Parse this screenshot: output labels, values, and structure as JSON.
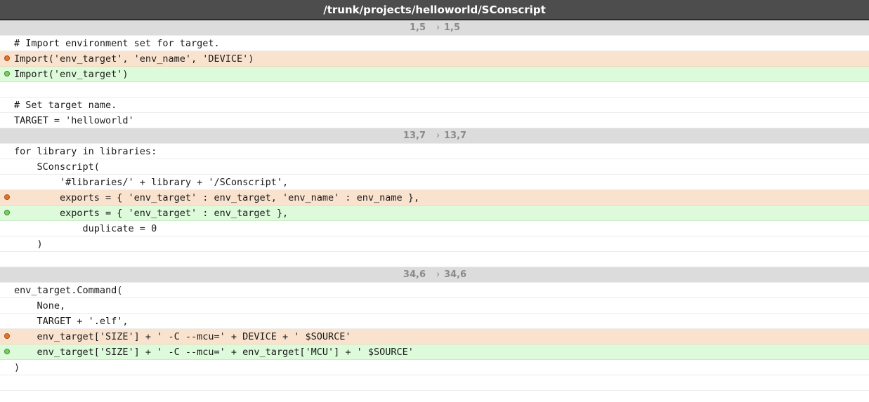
{
  "title": "/trunk/projects/helloworld/SConscript",
  "hunks": [
    {
      "left": "1,5",
      "right": "1,5",
      "lines": [
        {
          "type": "ctx",
          "text": "# Import environment set for target."
        },
        {
          "type": "del",
          "text": "Import('env_target', 'env_name', 'DEVICE')"
        },
        {
          "type": "add",
          "text": "Import('env_target')"
        },
        {
          "type": "ctx",
          "text": ""
        },
        {
          "type": "ctx",
          "text": "# Set target name."
        },
        {
          "type": "ctx",
          "text": "TARGET = 'helloworld'"
        }
      ]
    },
    {
      "left": "13,7",
      "right": "13,7",
      "lines": [
        {
          "type": "ctx",
          "text": "for library in libraries:"
        },
        {
          "type": "ctx",
          "text": "    SConscript("
        },
        {
          "type": "ctx",
          "text": "        '#libraries/' + library + '/SConscript',"
        },
        {
          "type": "del",
          "text": "        exports = { 'env_target' : env_target, 'env_name' : env_name },"
        },
        {
          "type": "add",
          "text": "        exports = { 'env_target' : env_target },"
        },
        {
          "type": "ctx",
          "text": "            duplicate = 0"
        },
        {
          "type": "ctx",
          "text": "    )"
        },
        {
          "type": "ctx",
          "text": ""
        }
      ]
    },
    {
      "left": "34,6",
      "right": "34,6",
      "lines": [
        {
          "type": "ctx",
          "text": "env_target.Command("
        },
        {
          "type": "ctx",
          "text": "    None,"
        },
        {
          "type": "ctx",
          "text": "    TARGET + '.elf',"
        },
        {
          "type": "del",
          "text": "    env_target['SIZE'] + ' -C --mcu=' + DEVICE + ' $SOURCE'"
        },
        {
          "type": "add",
          "text": "    env_target['SIZE'] + ' -C --mcu=' + env_target['MCU'] + ' $SOURCE'"
        },
        {
          "type": "ctx",
          "text": ")"
        },
        {
          "type": "ctx",
          "text": ""
        }
      ]
    }
  ],
  "arrow_glyph": "›",
  "colors": {
    "title_bg": "#4d4d4d",
    "hunk_bg": "#dcdcdc",
    "deleted_bg": "#f9e3cf",
    "added_bg": "#ddfadb",
    "deleted_marker": "#e8742c",
    "added_marker": "#7ccf68"
  }
}
